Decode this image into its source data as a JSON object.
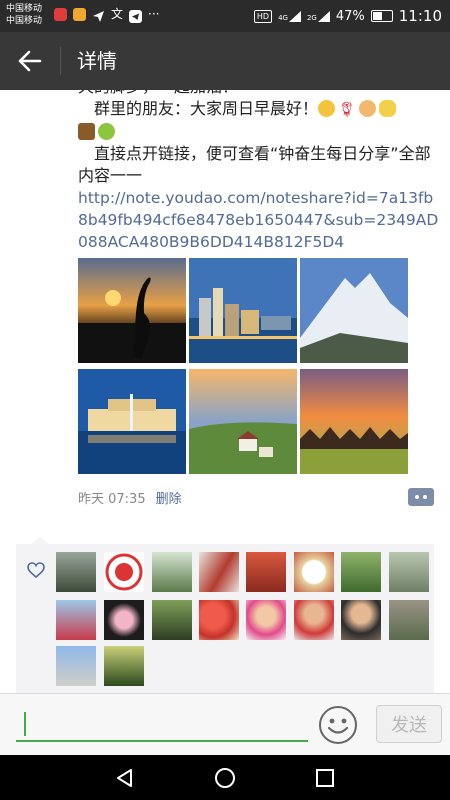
{
  "status_bar": {
    "carrier_1": "中国移动",
    "carrier_2": "中国移动",
    "network_1": "4G",
    "network_2": "2G",
    "hd": "HD",
    "battery": "47%",
    "time": "11:10"
  },
  "nav": {
    "title": "详情"
  },
  "post": {
    "line_0": "天的脚步，一起加油！",
    "line_1": "群里的朋友：大家周日早晨好！",
    "line_2": "直接点开链接，便可查看“钟奋生每日分享”全部内容一一",
    "link": "http://note.youdao.com/noteshare?id=7a13fb8b49fb494cf6e8478eb1650447&sub=2349AD088ACA480B9B6DD414B812F5D4",
    "time": "昨天 07:35",
    "delete_label": "删除"
  },
  "input": {
    "placeholder": "",
    "send_label": "发送"
  },
  "colors": {
    "link": "#536b95",
    "nav_bg": "#383838",
    "input_accent": "#4aa84a"
  }
}
